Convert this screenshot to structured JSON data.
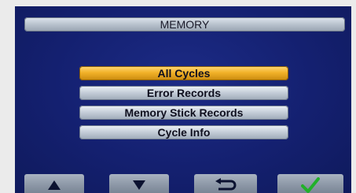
{
  "header": {
    "title": "MEMORY"
  },
  "menu": {
    "items": [
      {
        "label": "All Cycles",
        "selected": true
      },
      {
        "label": "Error Records",
        "selected": false
      },
      {
        "label": "Memory Stick Records",
        "selected": false
      },
      {
        "label": "Cycle Info",
        "selected": false
      }
    ]
  },
  "softkeys": [
    {
      "icon": "up-arrow-icon"
    },
    {
      "icon": "down-arrow-icon"
    },
    {
      "icon": "return-icon"
    },
    {
      "icon": "checkmark-icon"
    }
  ],
  "colors": {
    "screen_background": "#142070",
    "selected_item": "#f2b229",
    "checkmark": "#22b02a"
  }
}
